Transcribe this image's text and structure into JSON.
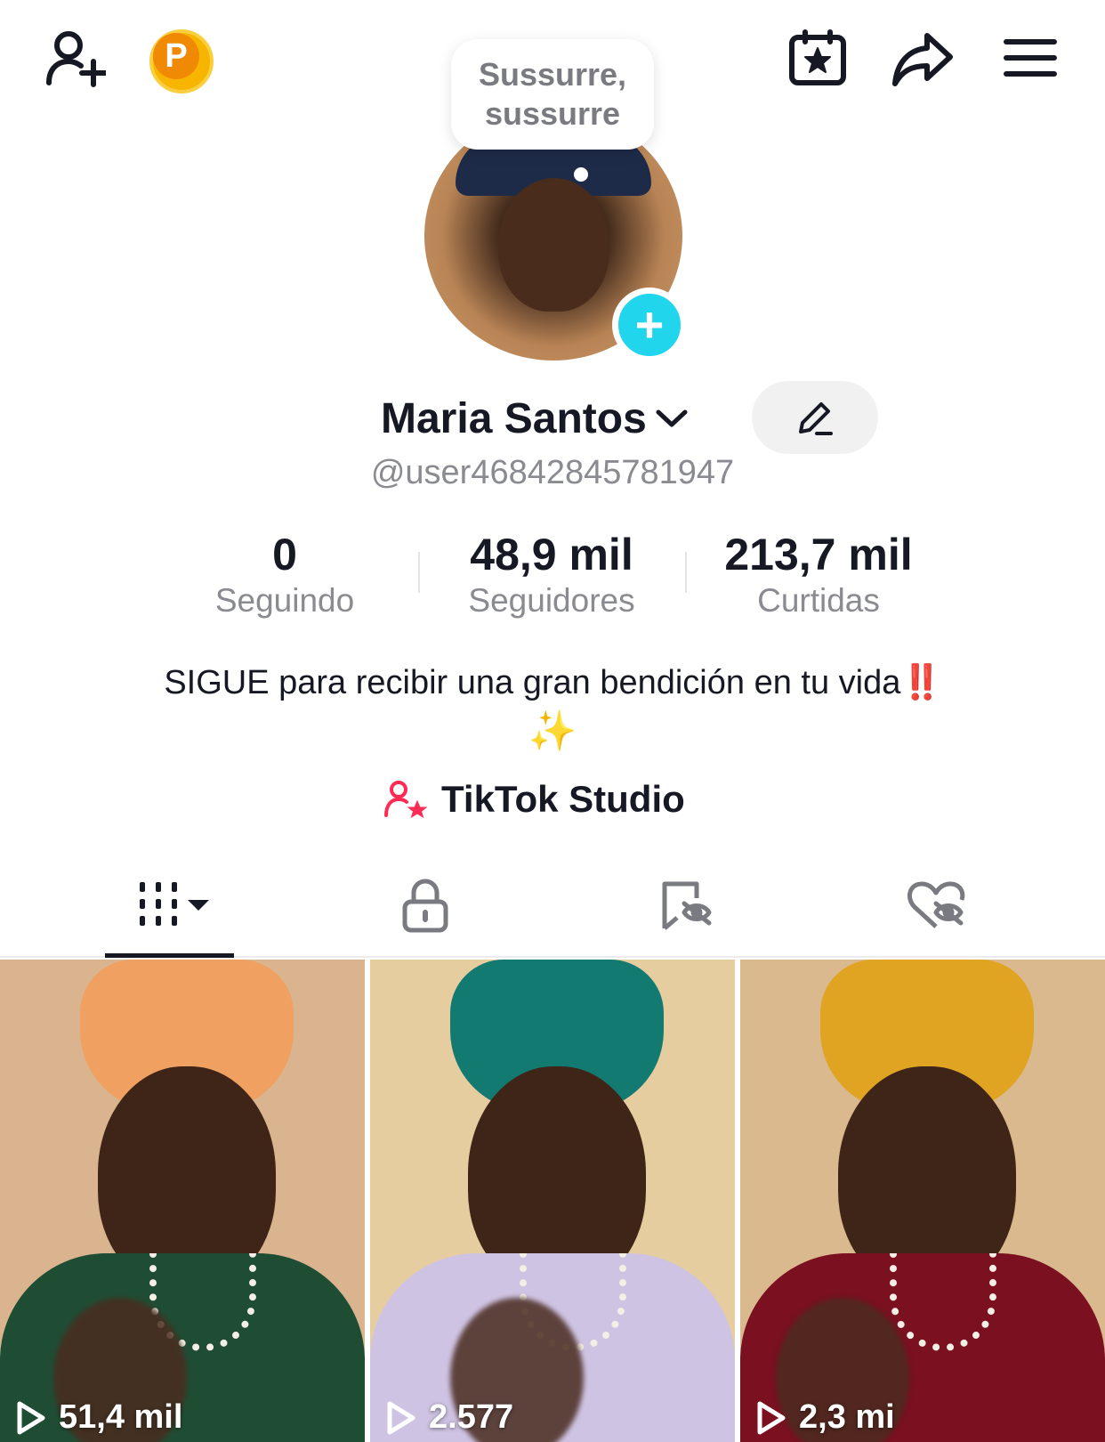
{
  "header": {
    "coin_letter": "P"
  },
  "tooltip": {
    "text": "Sussurre,\nsussurre"
  },
  "profile": {
    "name": "Maria Santos",
    "handle": "@user46842845781947"
  },
  "stats": [
    {
      "value": "0",
      "label": "Seguindo"
    },
    {
      "value": "48,9 mil",
      "label": "Seguidores"
    },
    {
      "value": "213,7 mil",
      "label": "Curtidas"
    }
  ],
  "bio": {
    "text": "SIGUE para recibir una gran bendición en tu vida",
    "emoji_excl": "‼️",
    "emoji_sparkles": "✨"
  },
  "studio": {
    "label": "TikTok Studio"
  },
  "tabs": [
    {
      "icon": "videos-grid-icon",
      "active": true
    },
    {
      "icon": "lock-icon",
      "active": false
    },
    {
      "icon": "saved-hidden-icon",
      "active": false
    },
    {
      "icon": "liked-hidden-icon",
      "active": false
    }
  ],
  "videos": [
    {
      "views": "51,4 mil",
      "turban_color": "#f0a060",
      "outfit_color": "#1f4d34",
      "bg_color": "#d9b48f"
    },
    {
      "views": "2.577",
      "turban_color": "#137a72",
      "outfit_color": "#cfc3e3",
      "bg_color": "#e6cda0"
    },
    {
      "views": "2,3 mi",
      "turban_color": "#e0a422",
      "outfit_color": "#7a1020",
      "bg_color": "#d9b98d"
    }
  ],
  "colors": {
    "accent_cyan": "#20d5ec",
    "coin_orange": "#f08a05",
    "studio_pink": "#fe2c55"
  }
}
